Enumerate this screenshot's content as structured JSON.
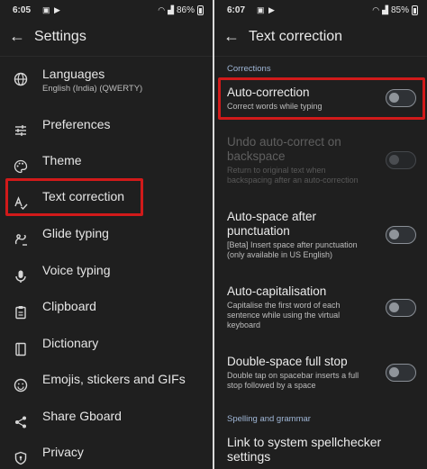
{
  "left": {
    "status": {
      "time": "6:05",
      "battery": "86%"
    },
    "title": "Settings",
    "items": [
      {
        "label": "Languages",
        "sublabel": "English (India) (QWERTY)"
      },
      {
        "label": "Preferences"
      },
      {
        "label": "Theme"
      },
      {
        "label": "Text correction"
      },
      {
        "label": "Glide typing"
      },
      {
        "label": "Voice typing"
      },
      {
        "label": "Clipboard"
      },
      {
        "label": "Dictionary"
      },
      {
        "label": "Emojis, stickers and GIFs"
      },
      {
        "label": "Share Gboard"
      },
      {
        "label": "Privacy"
      }
    ]
  },
  "right": {
    "status": {
      "time": "6:07",
      "battery": "85%"
    },
    "title": "Text correction",
    "section_corrections": "Corrections",
    "prefs": [
      {
        "title": "Auto-correction",
        "subtitle": "Correct words while typing",
        "enabled": true,
        "checked": false
      },
      {
        "title": "Undo auto-correct on backspace",
        "subtitle": "Return to original text when backspacing after an auto-correction",
        "enabled": false,
        "checked": false
      },
      {
        "title": "Auto-space after punctuation",
        "subtitle": "[Beta] Insert space after punctuation (only available in US English)",
        "enabled": true,
        "checked": false
      },
      {
        "title": "Auto-capitalisation",
        "subtitle": "Capitalise the first word of each sentence while using the virtual keyboard",
        "enabled": true,
        "checked": false
      },
      {
        "title": "Double-space full stop",
        "subtitle": "Double tap on spacebar inserts a full stop followed by a space",
        "enabled": true,
        "checked": false
      }
    ],
    "section_spelling": "Spelling and grammar",
    "link_spellchecker": "Link to system spellchecker settings"
  },
  "colors": {
    "background": "#1f1f1f",
    "highlight": "#d11a1a",
    "section": "#9fb6d6"
  },
  "icons": [
    "globe-icon",
    "sliders-icon",
    "palette-icon",
    "text-correction-icon",
    "glide-icon",
    "microphone-icon",
    "clipboard-icon",
    "dictionary-icon",
    "emoji-icon",
    "share-icon",
    "privacy-shield-icon"
  ]
}
